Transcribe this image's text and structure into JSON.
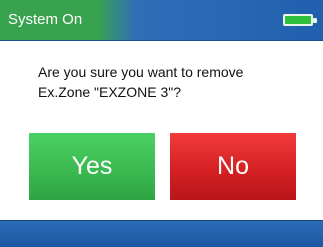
{
  "status_bar": {
    "title": "System On",
    "battery_icon": "battery-full-icon",
    "colors": {
      "accent_green": "#39a24e",
      "accent_blue": "#1f5fae"
    }
  },
  "dialog": {
    "message_line1": "Are you sure you want to remove",
    "message_line2": "Ex.Zone \"EXZONE 3\"?",
    "yes_label": "Yes",
    "no_label": "No",
    "colors": {
      "yes": "#3ab84f",
      "no": "#d21f22"
    }
  }
}
